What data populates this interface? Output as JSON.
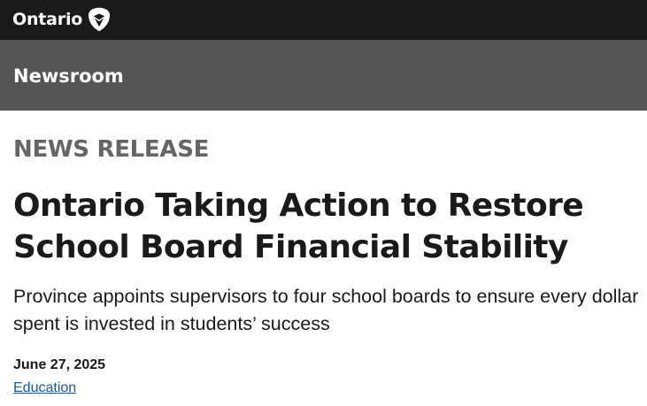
{
  "header": {
    "logo_text": "Ontario",
    "logo_icon": "trillium-icon",
    "background": "#1a1a1a"
  },
  "subheader": {
    "title": "Newsroom",
    "background": "#555555"
  },
  "article": {
    "kicker": "NEWS RELEASE",
    "headline": "Ontario Taking Action to Restore School Board Financial Stability",
    "subheadline": "Province appoints supervisors to four school boards to ensure every dollar spent is invested in students’ success",
    "date": "June 27, 2025",
    "category_link": "Education",
    "link_color": "#1a5a96"
  }
}
